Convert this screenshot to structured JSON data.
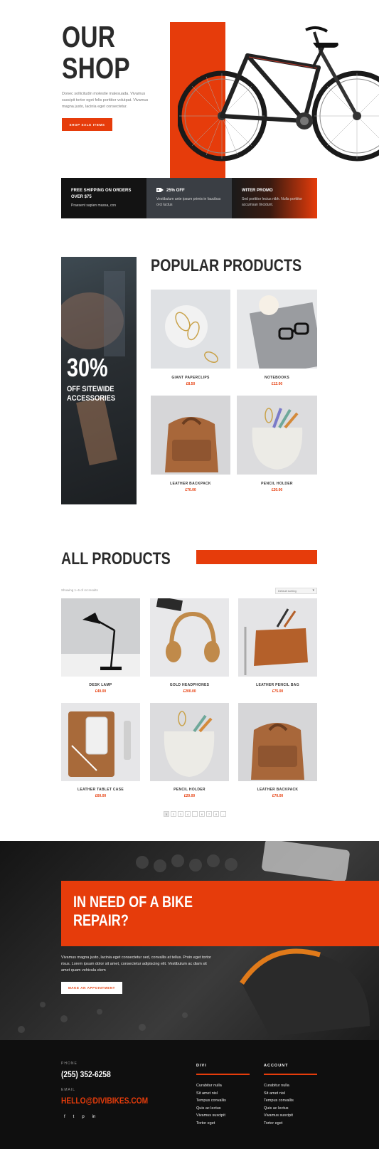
{
  "hero": {
    "title_line1": "OUR",
    "title_line2": "SHOP",
    "text": "Donec sollicitudin molestie malesuada. Vivamus suscipit tortor eget felis porttitor volutpat. Vivamus magna justo, lacinia eget consectetur.",
    "button": "SHOP SALE ITEMS"
  },
  "promos": [
    {
      "title": "FREE SHIPPING ON ORDERS OVER $75",
      "text": "Praesent sapien massa, con"
    },
    {
      "title": "25% OFF",
      "text": "Vestibulum ante ipsum primis in faucibus orci luctus"
    },
    {
      "title": "WITER PROMO",
      "text": "Sed porttitor lectus nibh. Nulla porttitor accumsan tincidunt."
    }
  ],
  "popular": {
    "banner_pct": "30%",
    "banner_text": "OFF SITEWIDE ACCESSORIES",
    "title": "POPULAR PRODUCTS",
    "items": [
      {
        "name": "GIANT PAPERCLIPS",
        "price": "£8.50"
      },
      {
        "name": "NOTEBOOKS",
        "price": "£12.00"
      },
      {
        "name": "LEATHER BACKPACK",
        "price": "£70.00"
      },
      {
        "name": "PENCIL HOLDER",
        "price": "£20.00"
      }
    ]
  },
  "all": {
    "title": "ALL PRODUCTS",
    "showing": "Showing 1–6 of 44 results",
    "sorting": "Default sorting",
    "items": [
      {
        "name": "DESK LAMP",
        "price": "£40.00"
      },
      {
        "name": "GOLD HEADPHONES",
        "price": "£200.00"
      },
      {
        "name": "LEATHER PENCIL BAG",
        "price": "£75.00"
      },
      {
        "name": "LEATHER TABLET CASE",
        "price": "£60.00"
      },
      {
        "name": "PENCIL HOLDER",
        "price": "£20.00"
      },
      {
        "name": "LEATHER BACKPACK",
        "price": "£70.00"
      }
    ],
    "pages": [
      "1",
      "2",
      "3",
      "4",
      "…",
      "6",
      "7",
      "8",
      "→"
    ]
  },
  "repair": {
    "title": "IN NEED OF A BIKE REPAIR?",
    "text": "Vivamus magna justo, lacinia eget consectetur sed, convallis at tellus. Proin eget tortor risus. Lorem ipsum dolor sit amet, consectetur adipiscing elit. Vestibulum ac diam sit amet quam vehicula elem",
    "button": "MAKE AN APPOINTMENT"
  },
  "footer": {
    "phone_label": "PHONE",
    "phone": "(255) 352-6258",
    "email_label": "EMAIL",
    "email": "HELLO@DIVIBIKES.COM",
    "social": [
      "f",
      "t",
      "p",
      "in"
    ],
    "col1_title": "DIVI",
    "col1_links": [
      "Curabitur nulla",
      "Sit amet nisl",
      "Tempus convallis",
      "Quis ac lectus",
      "Vivamus suscipit",
      "Tortor eget"
    ],
    "col2_title": "ACCOUNT",
    "col2_links": [
      "Curabitur nulla",
      "Sit amet nisl",
      "Tempus convallis",
      "Quis ac lectus",
      "Vivamus suscipit",
      "Tortor eget"
    ]
  },
  "colors": {
    "accent": "#e63c0b",
    "dark": "#0f0f0f"
  }
}
